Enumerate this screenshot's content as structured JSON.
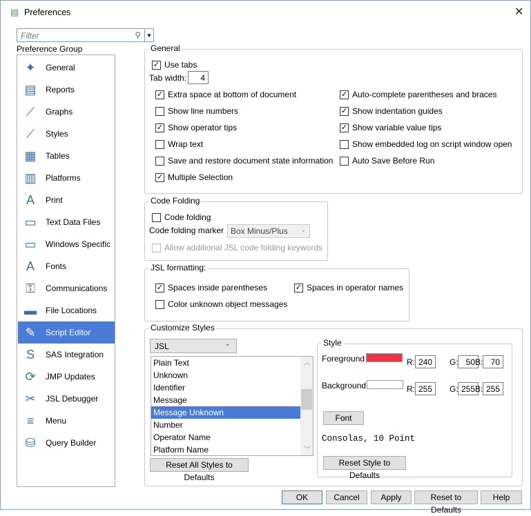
{
  "window": {
    "title": "Preferences",
    "close": "✕"
  },
  "filter": {
    "placeholder": "Filter"
  },
  "preference_group_label": "Preference Group",
  "groups": [
    {
      "label": "General",
      "icon": "general-icon"
    },
    {
      "label": "Reports",
      "icon": "reports-icon"
    },
    {
      "label": "Graphs",
      "icon": "graphs-icon"
    },
    {
      "label": "Styles",
      "icon": "styles-icon"
    },
    {
      "label": "Tables",
      "icon": "tables-icon"
    },
    {
      "label": "Platforms",
      "icon": "platforms-icon"
    },
    {
      "label": "Print",
      "icon": "print-icon"
    },
    {
      "label": "Text Data Files",
      "icon": "text-data-files-icon"
    },
    {
      "label": "Windows Specific",
      "icon": "windows-specific-icon"
    },
    {
      "label": "Fonts",
      "icon": "fonts-icon"
    },
    {
      "label": "Communications",
      "icon": "communications-icon"
    },
    {
      "label": "File Locations",
      "icon": "file-locations-icon"
    },
    {
      "label": "Script Editor",
      "icon": "script-editor-icon",
      "selected": true
    },
    {
      "label": "SAS Integration",
      "icon": "sas-integration-icon"
    },
    {
      "label": "JMP Updates",
      "icon": "jmp-updates-icon"
    },
    {
      "label": "JSL Debugger",
      "icon": "jsl-debugger-icon"
    },
    {
      "label": "Menu",
      "icon": "menu-icon"
    },
    {
      "label": "Query Builder",
      "icon": "query-builder-icon"
    }
  ],
  "general": {
    "title": "General",
    "use_tabs": {
      "label": "Use tabs",
      "checked": true
    },
    "tab_width_label": "Tab width:",
    "tab_width": "4",
    "options_left": [
      {
        "label": "Extra space at bottom of document",
        "checked": true
      },
      {
        "label": "Show line numbers",
        "checked": false
      },
      {
        "label": "Show operator tips",
        "checked": true
      },
      {
        "label": "Wrap text",
        "checked": false
      },
      {
        "label": "Save and restore document state information",
        "checked": false
      },
      {
        "label": "Multiple Selection",
        "checked": true
      }
    ],
    "options_right": [
      {
        "label": "Auto-complete parentheses and braces",
        "checked": true
      },
      {
        "label": "Show indentation guides",
        "checked": true
      },
      {
        "label": "Show variable value tips",
        "checked": true
      },
      {
        "label": "Show embedded log on script window open",
        "checked": false
      },
      {
        "label": "Auto Save Before Run",
        "checked": false
      }
    ]
  },
  "code_folding": {
    "title": "Code Folding",
    "enable": {
      "label": "Code folding",
      "checked": false
    },
    "marker_label": "Code folding marker",
    "marker_value": "Box Minus/Plus",
    "allow_keywords": {
      "label": "Allow additional JSL code folding keywords",
      "checked": false
    }
  },
  "jsl_formatting": {
    "title": "JSL formatting:",
    "options": [
      {
        "label": "Spaces inside parentheses",
        "checked": true
      },
      {
        "label": "Spaces in operator names",
        "checked": true
      },
      {
        "label": "Color unknown object messages",
        "checked": false
      }
    ]
  },
  "customize": {
    "title": "Customize Styles",
    "language": "JSL",
    "styles": [
      "Plain Text",
      "Unknown",
      "Identifier",
      "Message",
      "Message Unknown",
      "Number",
      "Operator Name",
      "Platform Name"
    ],
    "selected": "Message Unknown",
    "reset_all": "Reset All Styles to Defaults",
    "style": {
      "title": "Style",
      "foreground_label": "Foreground",
      "foreground_color": "#f03246",
      "fg": {
        "r": "240",
        "g": "50",
        "b": "70"
      },
      "background_label": "Background",
      "background_color": "#ffffff",
      "bg": {
        "r": "255",
        "g": "255",
        "b": "255"
      },
      "r_label": "R:",
      "g_label": "G:",
      "b_label": "B:",
      "font_button": "Font",
      "font_desc": "Consolas, 10 Point",
      "reset_style": "Reset Style to Defaults"
    }
  },
  "buttons": {
    "ok": "OK",
    "cancel": "Cancel",
    "apply": "Apply",
    "reset": "Reset to Defaults",
    "help": "Help"
  }
}
